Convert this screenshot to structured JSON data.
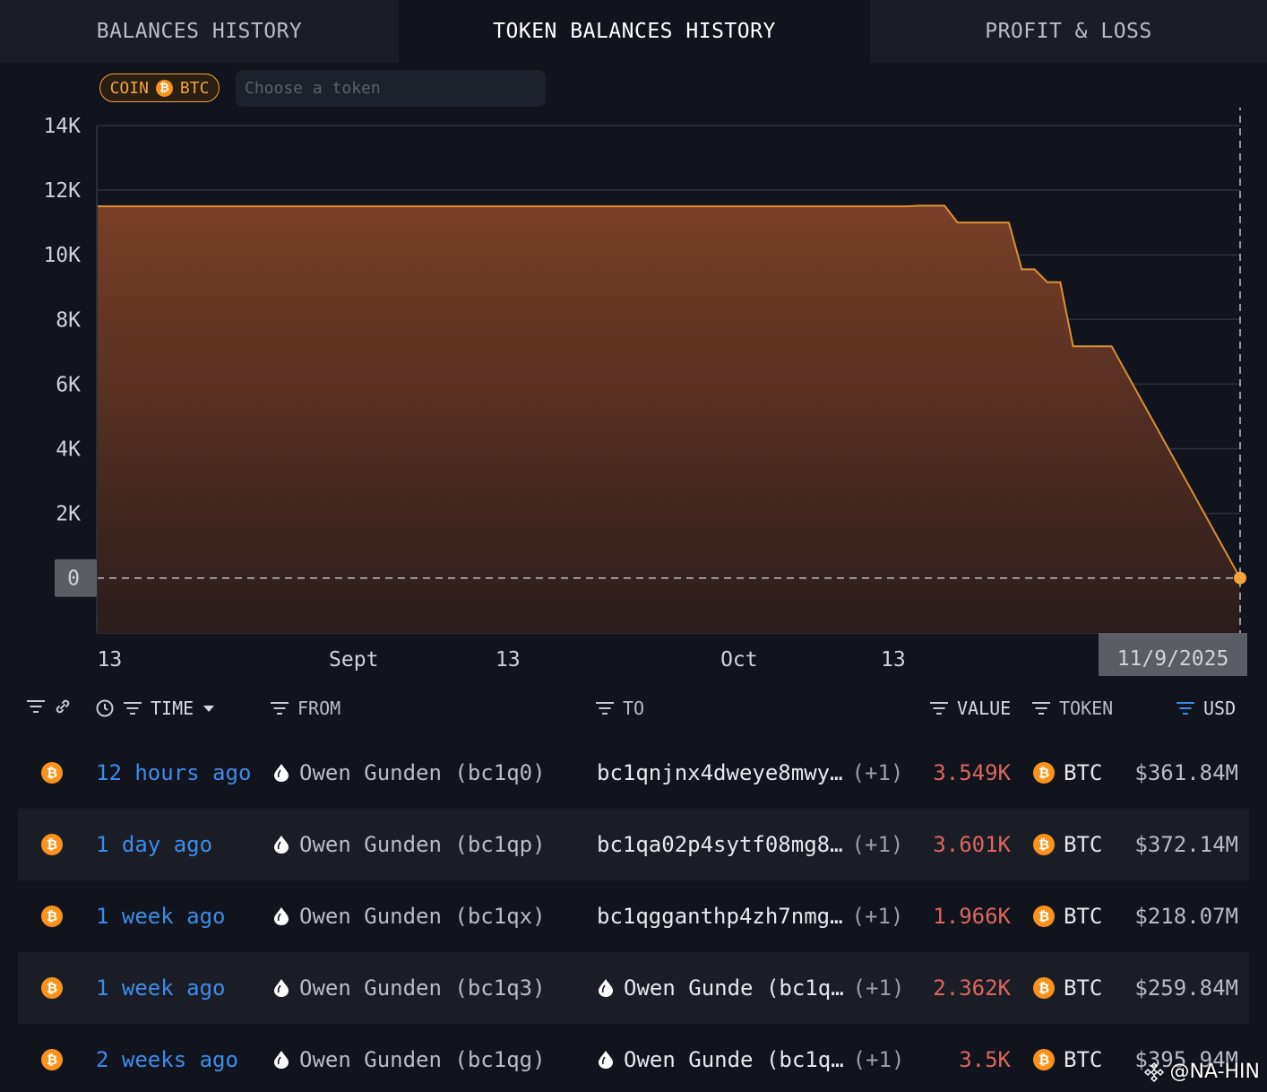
{
  "tabs": [
    {
      "label": "BALANCES HISTORY"
    },
    {
      "label": "TOKEN BALANCES HISTORY"
    },
    {
      "label": "PROFIT & LOSS"
    }
  ],
  "filter": {
    "coin_label": "COIN",
    "coin_symbol": "BTC",
    "token_placeholder": "Choose a token"
  },
  "colors": {
    "accent": "#f5a33a",
    "area_fill": "#7a3f27",
    "time_link": "#3d8ce8",
    "value_negative": "#d9675d"
  },
  "chart_data": {
    "type": "area",
    "ylim": [
      -1700,
      14000
    ],
    "y_ticks": [
      {
        "value": 14000,
        "label": "14K"
      },
      {
        "value": 12000,
        "label": "12K"
      },
      {
        "value": 10000,
        "label": "10K"
      },
      {
        "value": 8000,
        "label": "8K"
      },
      {
        "value": 6000,
        "label": "6K"
      },
      {
        "value": 4000,
        "label": "4K"
      },
      {
        "value": 2000,
        "label": "2K"
      },
      {
        "value": 0,
        "label": "0"
      }
    ],
    "x_ticks": [
      {
        "date": "2025-08-13",
        "label": "13"
      },
      {
        "date": "2025-09-01",
        "label": "Sept"
      },
      {
        "date": "2025-09-13",
        "label": "13"
      },
      {
        "date": "2025-10-01",
        "label": "Oct"
      },
      {
        "date": "2025-10-13",
        "label": "13"
      }
    ],
    "x_range": [
      "2025-08-12",
      "2025-11-09"
    ],
    "hover_label": "11/9/2025",
    "zero_label": "0",
    "points": [
      {
        "x": "2025-08-12",
        "y": 11500
      },
      {
        "x": "2025-10-14",
        "y": 11500
      },
      {
        "x": "2025-10-15",
        "y": 11520
      },
      {
        "x": "2025-10-17",
        "y": 11520
      },
      {
        "x": "2025-10-18",
        "y": 11000
      },
      {
        "x": "2025-10-22",
        "y": 11000
      },
      {
        "x": "2025-10-23",
        "y": 9550
      },
      {
        "x": "2025-10-24",
        "y": 9550
      },
      {
        "x": "2025-10-25",
        "y": 9150
      },
      {
        "x": "2025-10-26",
        "y": 9150
      },
      {
        "x": "2025-10-27",
        "y": 7170
      },
      {
        "x": "2025-10-30",
        "y": 7170
      },
      {
        "x": "2025-11-09",
        "y": 0
      }
    ]
  },
  "table": {
    "headers": {
      "time": "TIME",
      "from": "FROM",
      "to": "TO",
      "value": "VALUE",
      "token": "TOKEN",
      "usd": "USD"
    },
    "rows": [
      {
        "time": "12 hours ago",
        "from": "Owen Gunden (bc1q0)",
        "to": "bc1qnjnx4dweye8mwy…",
        "to_has_icon": false,
        "plus": "(+1)",
        "value": "3.549K",
        "token": "BTC",
        "usd": "$361.84M"
      },
      {
        "time": "1 day ago",
        "from": "Owen Gunden (bc1qp)",
        "to": "bc1qa02p4sytf08mg8…",
        "to_has_icon": false,
        "plus": "(+1)",
        "value": "3.601K",
        "token": "BTC",
        "usd": "$372.14M"
      },
      {
        "time": "1 week ago",
        "from": "Owen Gunden (bc1qx)",
        "to": "bc1qgganthp4zh7nmg…",
        "to_has_icon": false,
        "plus": "(+1)",
        "value": "1.966K",
        "token": "BTC",
        "usd": "$218.07M"
      },
      {
        "time": "1 week ago",
        "from": "Owen Gunden (bc1q3)",
        "to": "Owen Gunde (bc1q…",
        "to_has_icon": true,
        "plus": "(+1)",
        "value": "2.362K",
        "token": "BTC",
        "usd": "$259.84M"
      },
      {
        "time": "2 weeks ago",
        "from": "Owen Gunden (bc1qg)",
        "to": "Owen Gunde (bc1q…",
        "to_has_icon": true,
        "plus": "(+1)",
        "value": "3.5K",
        "token": "BTC",
        "usd": "$395.94M"
      }
    ]
  },
  "watermark": {
    "text": "@NA-HIN"
  }
}
